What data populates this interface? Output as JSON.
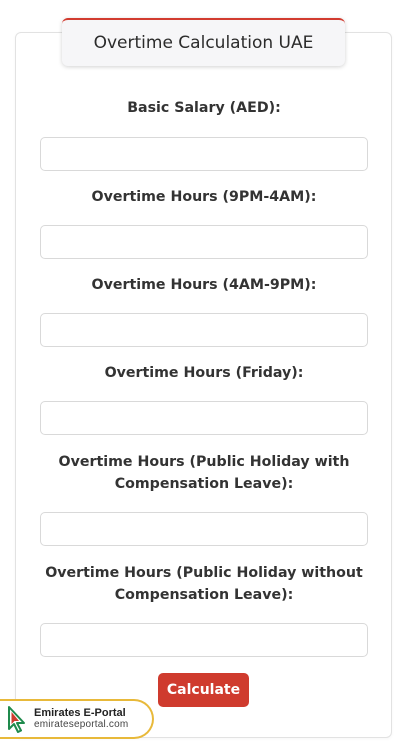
{
  "title": "Overtime Calculation UAE",
  "fields": [
    {
      "label": "Basic Salary (AED):",
      "value": ""
    },
    {
      "label": "Overtime Hours (9PM-4AM):",
      "value": ""
    },
    {
      "label": "Overtime Hours (4AM-9PM):",
      "value": ""
    },
    {
      "label": "Overtime Hours (Friday):",
      "value": ""
    },
    {
      "label_line1": "Overtime Hours (Public Holiday with",
      "label_line2": "Compensation Leave):",
      "value": ""
    },
    {
      "label_line1": "Overtime Hours (Public Holiday without",
      "label_line2": "Compensation Leave):",
      "value": ""
    }
  ],
  "calculate_label": "Calculate",
  "logo": {
    "name": "Emirates E-Portal",
    "url": "emirateseportal.com",
    "colors": {
      "accent_red": "#cf3b2e",
      "border_gold": "#e8b93a",
      "mark_green": "#1f8a4c",
      "mark_red": "#cf3b2e"
    }
  }
}
